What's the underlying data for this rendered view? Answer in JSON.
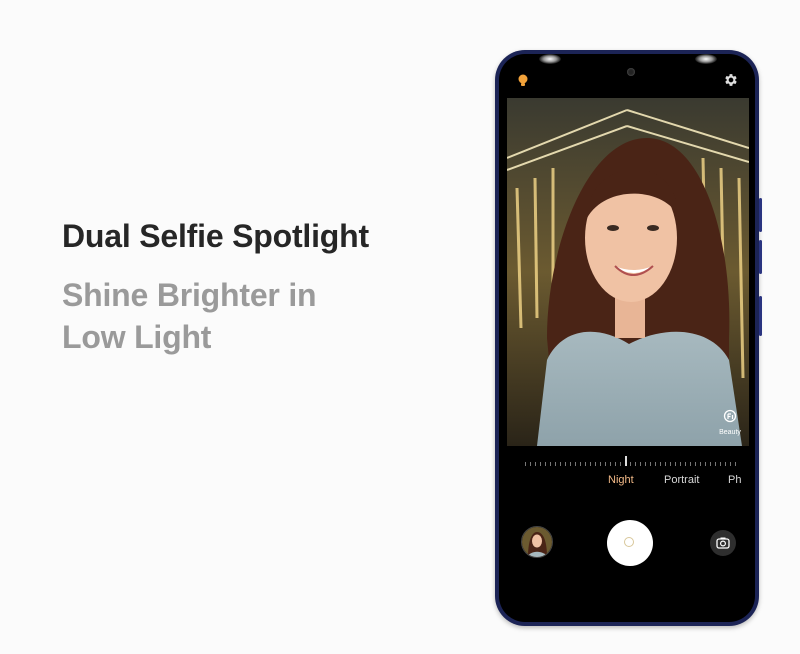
{
  "promo": {
    "headline": "Dual Selfie Spotlight",
    "subline_1": "Shine Brighter in",
    "subline_2": "Low Light"
  },
  "camera": {
    "top_bar": {
      "left_icon": "bulb-icon",
      "right_icon": "gear-icon"
    },
    "beauty_label": "Beauty",
    "modes": [
      "Night",
      "Portrait",
      "Ph"
    ],
    "active_mode": "Night",
    "controls": {
      "gallery_icon": "gallery-thumbnail",
      "shutter_icon": "shutter-button",
      "switch_icon": "camera-switch-icon"
    },
    "colors": {
      "active_mode": "#f2b987",
      "phone_frame": "#1c2456"
    }
  }
}
